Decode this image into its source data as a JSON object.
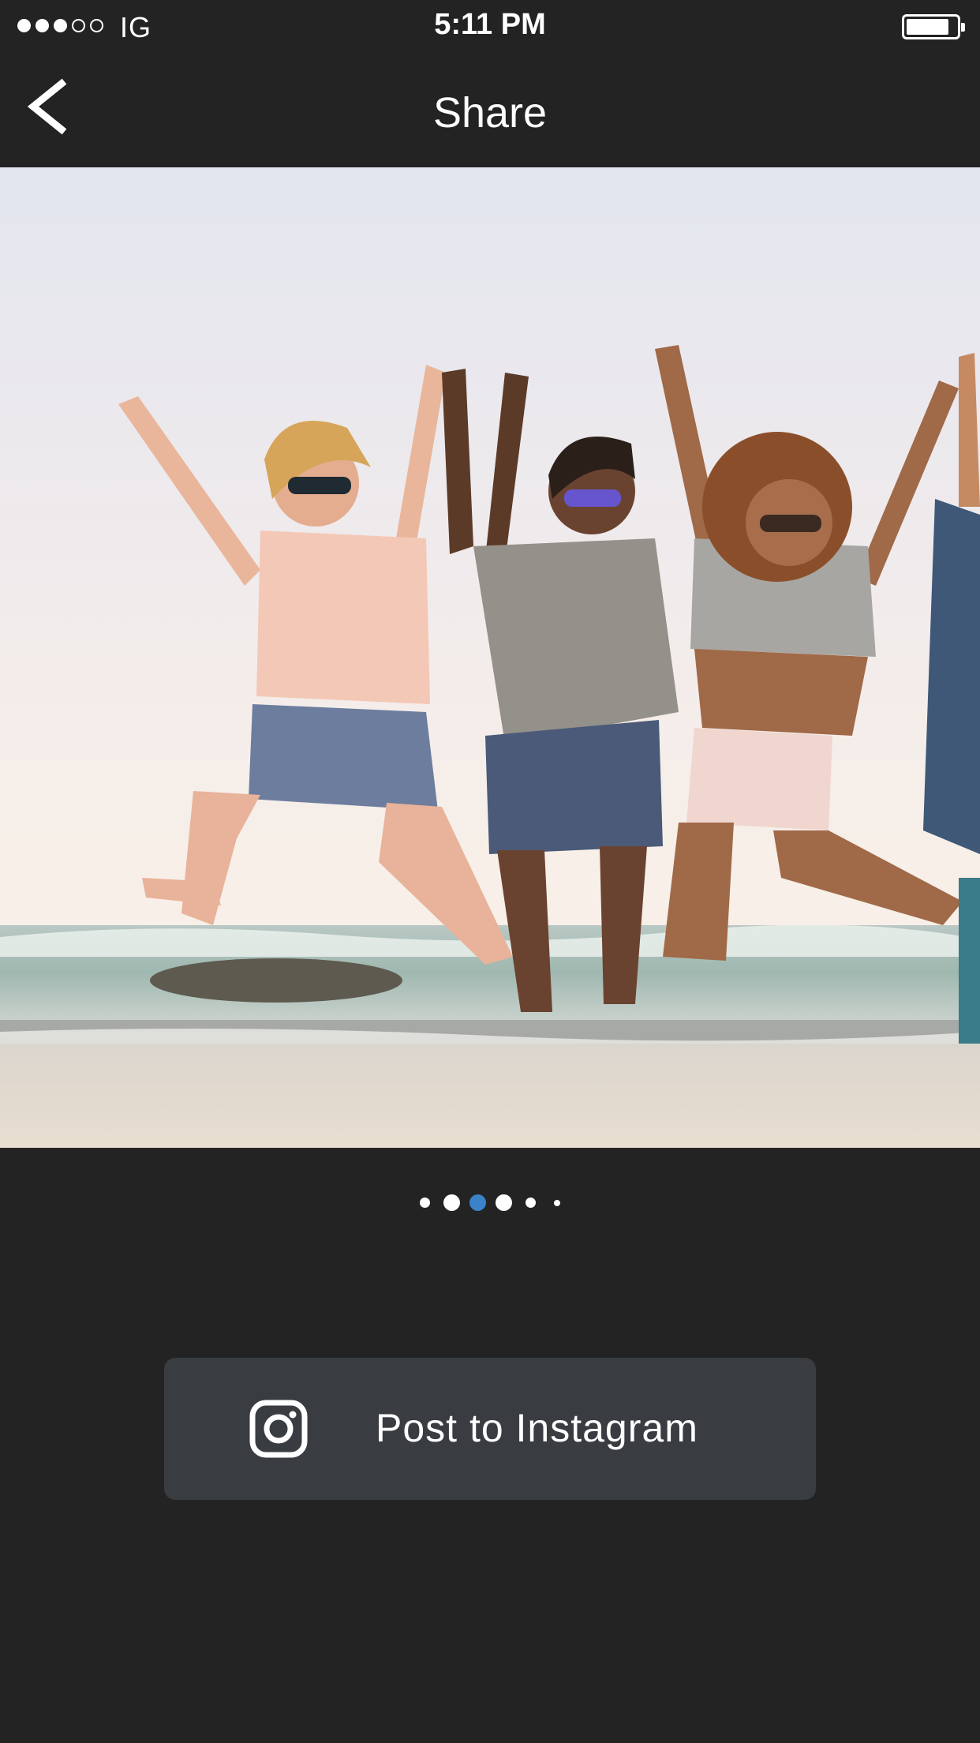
{
  "status_bar": {
    "signal_strength": 3,
    "signal_max": 5,
    "carrier": "IG",
    "time": "5:11 PM",
    "battery_level": 0.85
  },
  "nav": {
    "back_icon": "chevron-left-icon",
    "title": "Share"
  },
  "photo": {
    "content": "beach-photo"
  },
  "pager": {
    "page_count": 6,
    "active_index": 2,
    "active_color": "#3b82c8"
  },
  "post_button": {
    "icon": "instagram-icon",
    "label": "Post to Instagram",
    "background": "#393c40"
  }
}
